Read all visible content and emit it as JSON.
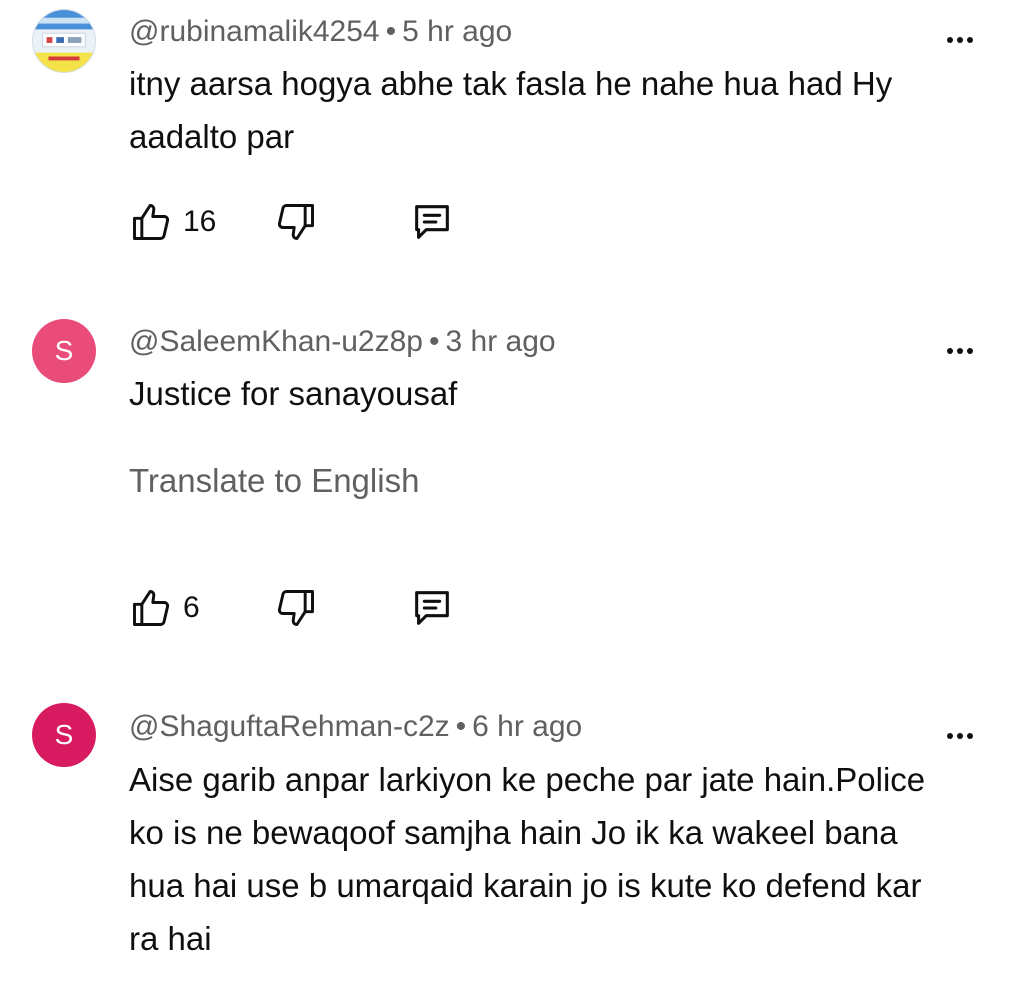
{
  "comments": [
    {
      "author": "@rubinamalik4254",
      "separator": "•",
      "time": "5 hr ago",
      "text": "itny aarsa hogya abhe tak fasla he nahe hua had Hy aadalto par",
      "likes": "16",
      "avatar_type": "image",
      "translate_label": ""
    },
    {
      "author": "@SaleemKhan-u2z8p",
      "separator": "•",
      "time": "3 hr ago",
      "text": "Justice for sanayousaf",
      "likes": "6",
      "avatar_type": "letter",
      "avatar_letter": "S",
      "avatar_color": "#ea4c7a",
      "translate_label": "Translate to English"
    },
    {
      "author": "@ShaguftaRehman-c2z",
      "separator": "•",
      "time": "6 hr ago",
      "text": "Aise garib anpar larkiyon ke peche par jate hain.Police ko is ne bewaqoof samjha hain Jo ik ka wakeel bana hua hai use b umarqaid karain jo is kute ko defend kar ra hai",
      "avatar_type": "letter",
      "avatar_letter": "S",
      "avatar_color": "#d81b60"
    }
  ],
  "icons": {
    "like": "thumbs-up-icon",
    "dislike": "thumbs-down-icon",
    "reply": "reply-comment-icon",
    "more": "more-vert-icon"
  }
}
